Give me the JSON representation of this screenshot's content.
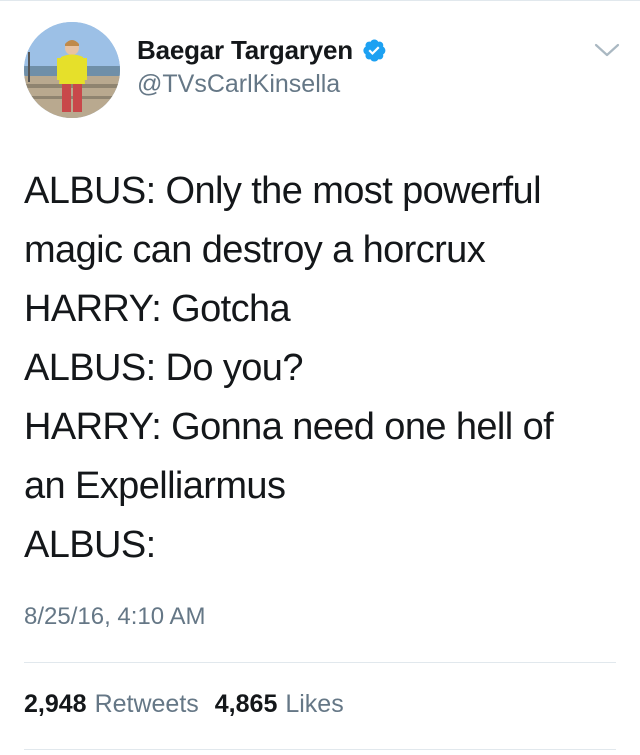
{
  "user": {
    "display_name": "Baegar Targaryen",
    "handle": "@TVsCarlKinsella",
    "verified": true,
    "verified_color": "#1da1f2"
  },
  "tweet": {
    "lines": [
      "ALBUS: Only the most powerful",
      "magic can destroy a horcrux",
      "HARRY: Gotcha",
      "ALBUS: Do you?",
      "HARRY: Gonna need one hell of",
      "an Expelliarmus",
      "ALBUS:"
    ],
    "timestamp": "8/25/16, 4:10 AM"
  },
  "stats": {
    "retweets_count": "2,948",
    "retweets_label": "Retweets",
    "likes_count": "4,865",
    "likes_label": "Likes"
  },
  "icons": {
    "verified": "verified-badge-icon",
    "menu": "chevron-down-icon"
  },
  "colors": {
    "text": "#14171a",
    "secondary": "#657786",
    "divider": "#e1e8ed"
  }
}
